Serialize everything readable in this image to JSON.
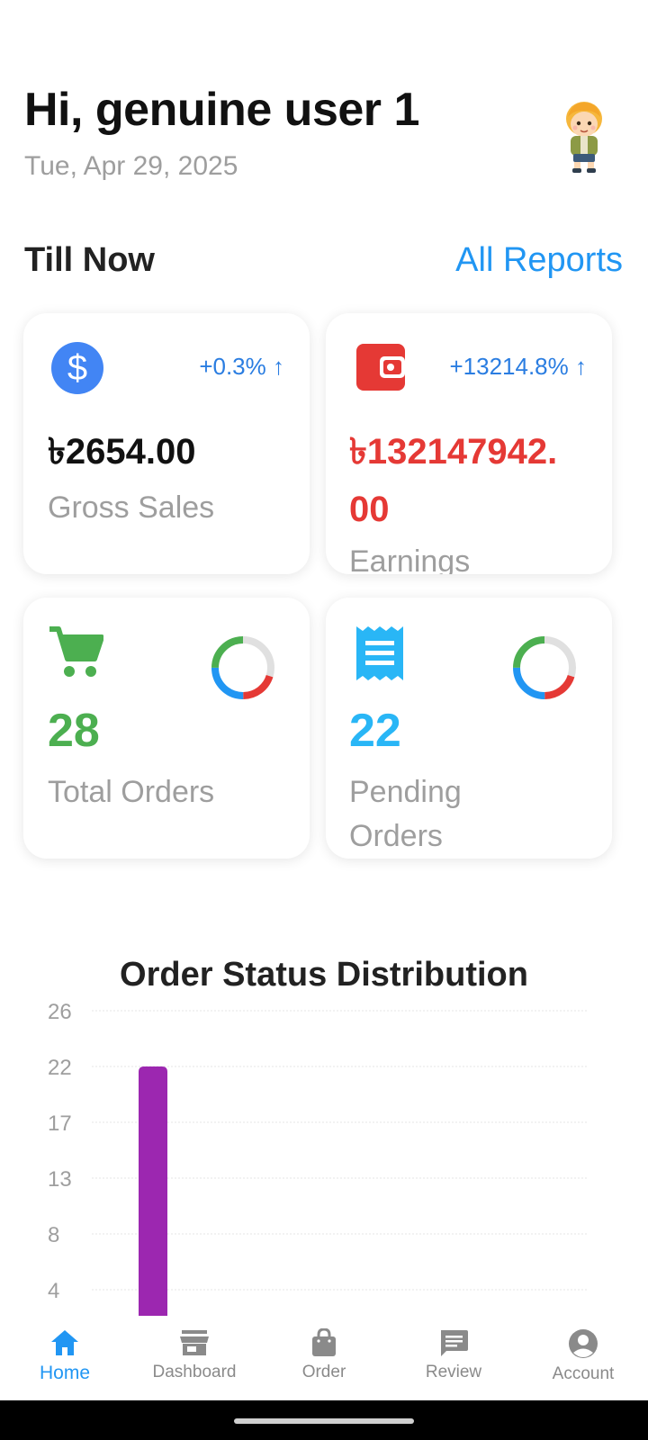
{
  "header": {
    "greeting": "Hi, genuine user 1",
    "date": "Tue, Apr 29, 2025",
    "avatar_icon": "cartoon-boy-avatar"
  },
  "section": {
    "title": "Till Now",
    "link_label": "All Reports"
  },
  "cards": {
    "gross_sales": {
      "icon": "dollar-circle-icon",
      "change": "+0.3%",
      "value": "৳2654.00",
      "label": "Gross Sales",
      "icon_color": "#4285f4"
    },
    "earnings": {
      "icon": "wallet-icon",
      "change": "+13214.8%",
      "value_line1": "৳132147942.",
      "value_line2": "00",
      "label": "Earnings",
      "color": "#e53935"
    },
    "total_orders": {
      "icon": "cart-icon",
      "value": "28",
      "label": "Total Orders",
      "color": "#4caf50"
    },
    "pending_orders": {
      "icon": "receipt-icon",
      "value": "22",
      "label_line1": "Pending",
      "label_line2": "Orders",
      "color": "#29b6f6"
    }
  },
  "donut_colors": [
    "#e0e0e0",
    "#e53935",
    "#2196f3",
    "#4caf50"
  ],
  "chart_data": {
    "type": "bar",
    "title": "Order Status Distribution",
    "y_ticks": [
      "26",
      "22",
      "17",
      "13",
      "8",
      "4"
    ],
    "values": [
      22
    ],
    "bar_color": "#9c27b0",
    "grid": true
  },
  "bottom_nav": {
    "items": [
      {
        "label": "Home",
        "icon": "home-icon",
        "active": true
      },
      {
        "label": "Dashboard",
        "icon": "store-icon",
        "active": false
      },
      {
        "label": "Order",
        "icon": "shopping-bag-icon",
        "active": false
      },
      {
        "label": "Review",
        "icon": "message-icon",
        "active": false
      },
      {
        "label": "Account",
        "icon": "account-circle-icon",
        "active": false
      }
    ],
    "active_color": "#2196f3",
    "inactive_color": "#8a8a8a"
  }
}
